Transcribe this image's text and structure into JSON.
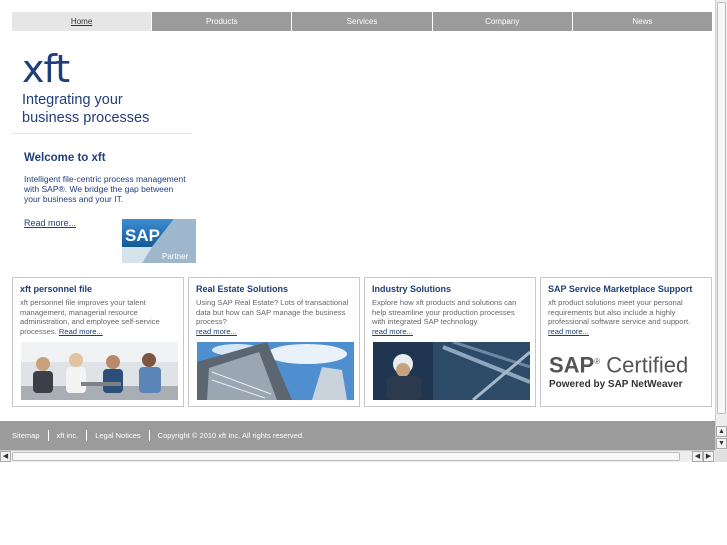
{
  "nav": {
    "items": [
      "Home",
      "Products",
      "Services",
      "Company",
      "News"
    ]
  },
  "logo": {
    "mark": "xft",
    "tagline_1": "Integrating your",
    "tagline_2": "business processes"
  },
  "welcome": {
    "title": "Welcome to xft",
    "text": "Intelligent file-centric process management with SAP®. We bridge the gap between your business and your IT.",
    "link": "Read more..."
  },
  "sap_partner": {
    "brand": "SAP",
    "label": "Partner"
  },
  "cards": [
    {
      "title": "xft personnel file",
      "text": "xft personnel file improves your talent management, managerial resource administration, and employee self-service processes.",
      "link": "Read more..."
    },
    {
      "title": "Real Estate Solutions",
      "text": "Using SAP Real Estate? Lots of transactional data but how can SAP manage the business process?",
      "link": "read more..."
    },
    {
      "title": "Industry Solutions",
      "text": "Explore how xft products and solutions can help streamline your production processes with integrated SAP technology.",
      "link": "read more..."
    },
    {
      "title": "SAP Service Marketplace Support",
      "text": "xft product solutions meet your personal requirements but also include a highly professional software service and support.",
      "link": "read more..."
    }
  ],
  "certified": {
    "brand": "SAP",
    "word": "Certified",
    "powered": "Powered by SAP NetWeaver",
    "reg": "®"
  },
  "footer": {
    "items": [
      "Sitemap",
      "xft inc.",
      "Legal Notices",
      "Copyright © 2010 xft Inc. All rights reserved."
    ]
  },
  "colors": {
    "brand_blue": "#1f3f7a",
    "nav_gray": "#9b9b9b",
    "sap_blue": "#1a6bb0"
  }
}
